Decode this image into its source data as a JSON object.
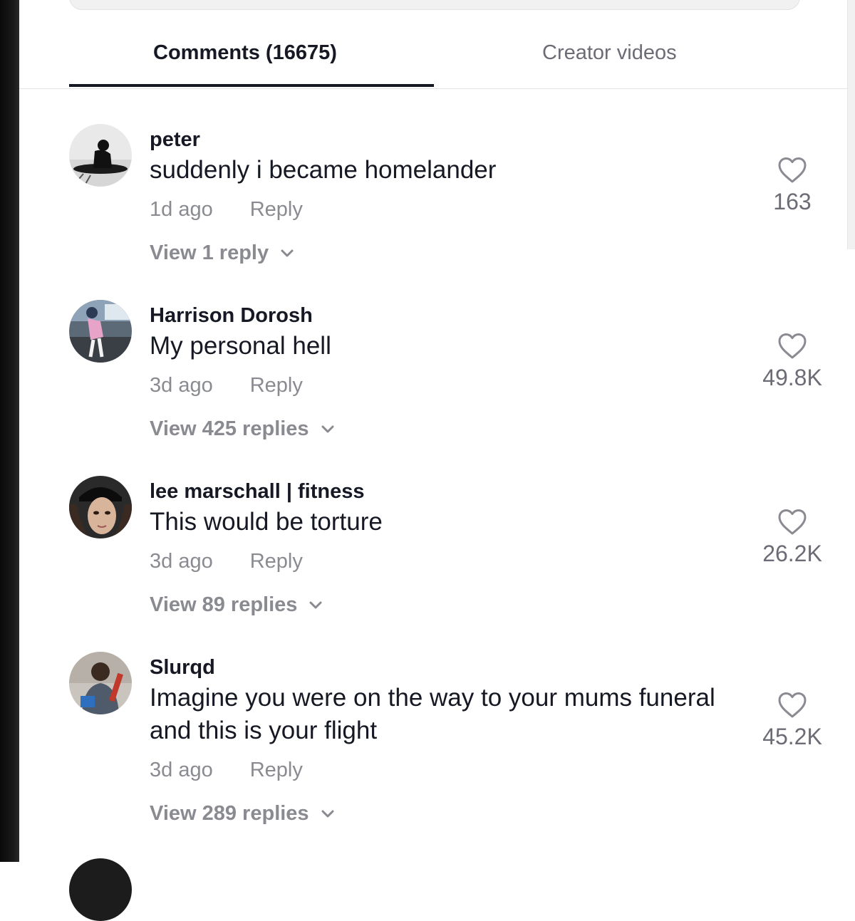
{
  "tabs": {
    "comments": "Comments (16675)",
    "creator_videos": "Creator videos"
  },
  "comments": [
    {
      "username": "peter",
      "text": "suddenly i became homelander",
      "time": "1d ago",
      "reply": "Reply",
      "view_replies": "View 1 reply",
      "likes": "163"
    },
    {
      "username": "Harrison Dorosh",
      "text": "My personal hell",
      "time": "3d ago",
      "reply": "Reply",
      "view_replies": "View 425 replies",
      "likes": "49.8K"
    },
    {
      "username": "lee marschall | fitness",
      "text": "This would be torture",
      "time": "3d ago",
      "reply": "Reply",
      "view_replies": "View 89 replies",
      "likes": "26.2K"
    },
    {
      "username": "Slurqd",
      "text": "Imagine you were on the way to your mums funeral and this is your flight",
      "time": "3d ago",
      "reply": "Reply",
      "view_replies": "View 289 replies",
      "likes": "45.2K"
    }
  ],
  "icons": {
    "like": "heart-outline-icon",
    "expand": "chevron-down-icon"
  },
  "colors": {
    "primary_text": "#161823",
    "secondary_text": "#8a8b91",
    "tab_underline": "#161823"
  }
}
